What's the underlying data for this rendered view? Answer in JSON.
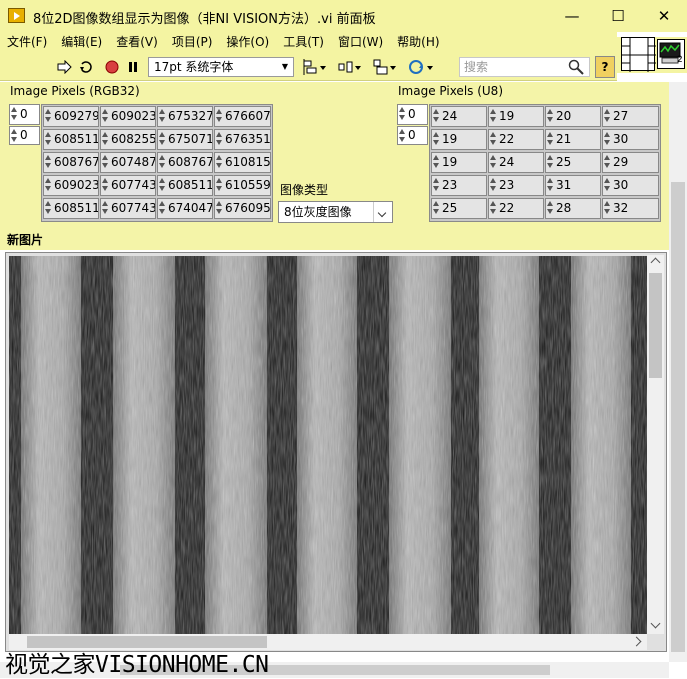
{
  "window": {
    "title": "8位2D图像数组显示为图像（非NI VISION方法）.vi 前面板",
    "minimize": "—",
    "maximize": "☐",
    "close": "✕"
  },
  "menu": [
    "文件(F)",
    "编辑(E)",
    "查看(V)",
    "项目(P)",
    "操作(O)",
    "工具(T)",
    "窗口(W)",
    "帮助(H)"
  ],
  "toolbar": {
    "font": "17pt 系统字体",
    "search_placeholder": "搜索",
    "help": "?"
  },
  "vi_icon_number": "2",
  "rgb_array": {
    "label": "Image Pixels (RGB32)",
    "index_row": "0",
    "index_col": "0",
    "rows": [
      [
        "609279",
        "609023",
        "675327",
        "676607"
      ],
      [
        "608511",
        "608255",
        "675071",
        "676351"
      ],
      [
        "608767",
        "607487",
        "608767",
        "610815"
      ],
      [
        "609023",
        "607743",
        "608511",
        "610559"
      ],
      [
        "608511",
        "607743",
        "674047",
        "676095"
      ]
    ]
  },
  "u8_array": {
    "label": "Image Pixels (U8)",
    "index_row": "0",
    "index_col": "0",
    "rows": [
      [
        "24",
        "19",
        "20",
        "27"
      ],
      [
        "19",
        "22",
        "21",
        "30"
      ],
      [
        "19",
        "24",
        "25",
        "29"
      ],
      [
        "23",
        "23",
        "31",
        "30"
      ],
      [
        "25",
        "22",
        "28",
        "32"
      ]
    ]
  },
  "image_type": {
    "label": "图像类型",
    "value": "8位灰度图像"
  },
  "picture": {
    "label": "新图片"
  },
  "watermark": {
    "cn": "视觉之家",
    "en": "VISIONHOME.CN"
  },
  "colors": {
    "panel_bg": "#f4f4a8",
    "titlebar_bg": "#f4f4a2"
  }
}
